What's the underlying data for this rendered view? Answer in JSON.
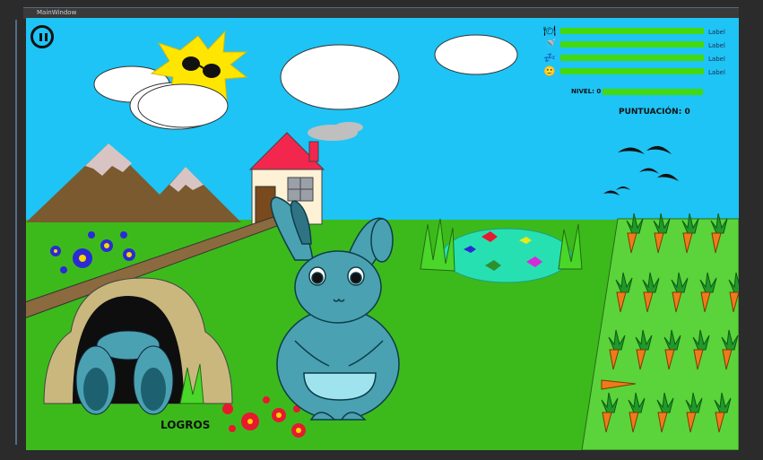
{
  "window": {
    "title": "MainWindow"
  },
  "hud": {
    "stats": [
      {
        "icon": "food-icon",
        "glyph": "🍽",
        "label": "Label",
        "level": 1.0
      },
      {
        "icon": "shower-icon",
        "glyph": "🚿",
        "label": "Label",
        "level": 1.0
      },
      {
        "icon": "sleep-icon",
        "glyph": "💤",
        "label": "Label",
        "level": 1.0
      },
      {
        "icon": "happiness-icon",
        "glyph": "🙂",
        "label": "Label",
        "level": 1.0
      }
    ],
    "level_label": "NIVEL: 0",
    "level_progress": 1.0,
    "score_label": "PUNTUACIÓN: 0"
  },
  "achievements_label": "LOGROS",
  "colors": {
    "sky": "#1ec4f5",
    "grass": "#3cba1c",
    "bar": "#42d911",
    "bunny": "#4aa1b2",
    "field": "#5ad43a"
  }
}
